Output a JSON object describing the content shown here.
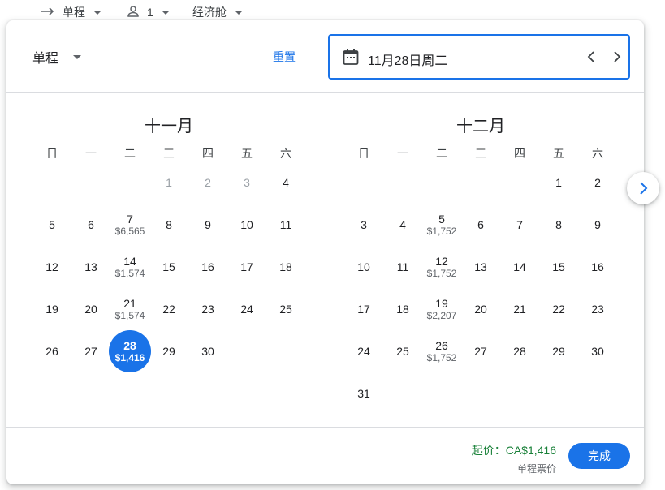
{
  "topbar": {
    "trip_type": "单程",
    "passengers": "1",
    "cabin": "经济舱"
  },
  "header": {
    "trip_select": "单程",
    "reset": "重置",
    "date_value": "11月28日周二"
  },
  "weekdays": [
    "日",
    "一",
    "二",
    "三",
    "四",
    "五",
    "六"
  ],
  "months": [
    {
      "title": "十一月",
      "days": [
        {
          "d": "1",
          "muted": true
        },
        {
          "d": "2",
          "muted": true
        },
        {
          "d": "3",
          "muted": true
        },
        {
          "d": "4"
        },
        {
          "d": "5"
        },
        {
          "d": "6"
        },
        {
          "d": "7",
          "p": "$6,565"
        },
        {
          "d": "8"
        },
        {
          "d": "9"
        },
        {
          "d": "10"
        },
        {
          "d": "11"
        },
        {
          "d": "12"
        },
        {
          "d": "13"
        },
        {
          "d": "14",
          "p": "$1,574"
        },
        {
          "d": "15"
        },
        {
          "d": "16"
        },
        {
          "d": "17"
        },
        {
          "d": "18"
        },
        {
          "d": "19"
        },
        {
          "d": "20"
        },
        {
          "d": "21",
          "p": "$1,574"
        },
        {
          "d": "22"
        },
        {
          "d": "23"
        },
        {
          "d": "24"
        },
        {
          "d": "25"
        },
        {
          "d": "26"
        },
        {
          "d": "27"
        },
        {
          "d": "28",
          "p": "$1,416",
          "selected": true
        },
        {
          "d": "29"
        },
        {
          "d": "30"
        }
      ]
    },
    {
      "title": "十二月",
      "days": [
        {
          "d": "1"
        },
        {
          "d": "2"
        },
        {
          "d": "3"
        },
        {
          "d": "4"
        },
        {
          "d": "5",
          "p": "$1,752"
        },
        {
          "d": "6"
        },
        {
          "d": "7"
        },
        {
          "d": "8"
        },
        {
          "d": "9"
        },
        {
          "d": "10"
        },
        {
          "d": "11"
        },
        {
          "d": "12",
          "p": "$1,752"
        },
        {
          "d": "13"
        },
        {
          "d": "14"
        },
        {
          "d": "15"
        },
        {
          "d": "16"
        },
        {
          "d": "17"
        },
        {
          "d": "18"
        },
        {
          "d": "19",
          "p": "$2,207"
        },
        {
          "d": "20"
        },
        {
          "d": "21"
        },
        {
          "d": "22"
        },
        {
          "d": "23"
        },
        {
          "d": "24"
        },
        {
          "d": "25"
        },
        {
          "d": "26",
          "p": "$1,752"
        },
        {
          "d": "27"
        },
        {
          "d": "28"
        },
        {
          "d": "29"
        },
        {
          "d": "30"
        },
        {
          "d": "31"
        }
      ]
    }
  ],
  "footer": {
    "price_main": "起价：CA$1,416",
    "price_sub": "单程票价",
    "done": "完成"
  },
  "colors": {
    "accent": "#1a73e8",
    "price_green": "#188038"
  }
}
